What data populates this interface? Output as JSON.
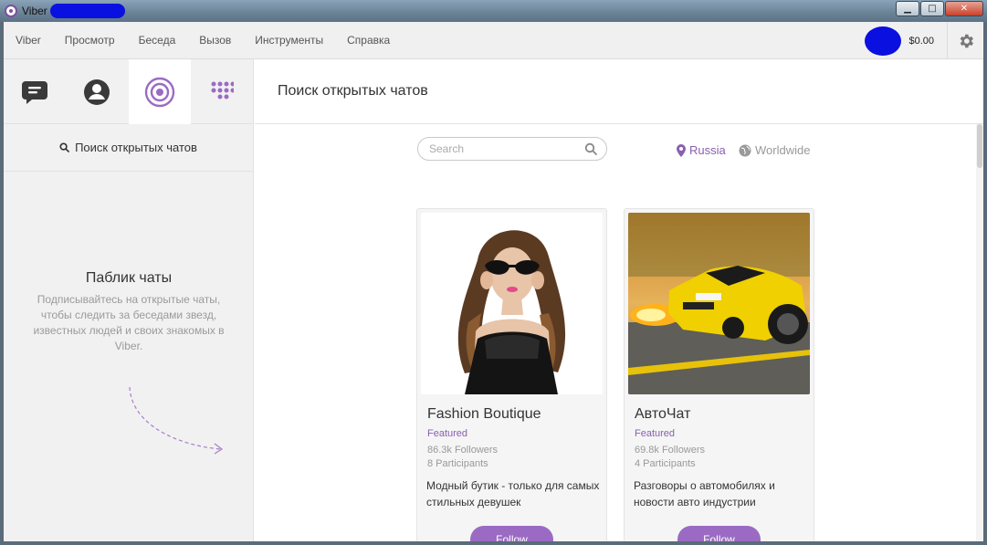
{
  "window": {
    "title": "Viber",
    "controls": {
      "minimize": "▁",
      "maximize": "□",
      "close": "✕"
    }
  },
  "menu": {
    "items": [
      "Viber",
      "Просмотр",
      "Беседа",
      "Вызов",
      "Инструменты",
      "Справка"
    ],
    "balance": "$0.00"
  },
  "sidebar": {
    "tabs": [
      {
        "name": "chats",
        "icon": "chat-bubble-icon"
      },
      {
        "name": "contacts",
        "icon": "contact-icon"
      },
      {
        "name": "public-chats",
        "icon": "public-chats-icon",
        "active": true
      },
      {
        "name": "dialpad",
        "icon": "dialpad-icon"
      }
    ],
    "search_label": "Поиск открытых чатов",
    "public_title": "Паблик чаты",
    "public_desc": "Подписывайтесь на открытые чаты, чтобы следить за беседами звезд, известных людей и своих знакомых в Viber."
  },
  "main": {
    "header_title": "Поиск открытых чатов",
    "search_placeholder": "Search",
    "regions": {
      "russia": "Russia",
      "worldwide": "Worldwide"
    },
    "cards": [
      {
        "name": "Fashion Boutique",
        "featured": "Featured",
        "followers": "86.3k Followers",
        "participants": "8 Participants",
        "description": "Модный бутик - только для самых стильных девушек",
        "follow_label": "Follow"
      },
      {
        "name": "АвтоЧат",
        "featured": "Featured",
        "followers": "69.8k Followers",
        "participants": "4 Participants",
        "description": "Разговоры о автомобилях и новости авто индустрии",
        "follow_label": "Follow"
      }
    ]
  },
  "colors": {
    "accent": "#9b6bc3",
    "accent_text": "#8a5fb0",
    "redaction": "#0a10e0"
  }
}
